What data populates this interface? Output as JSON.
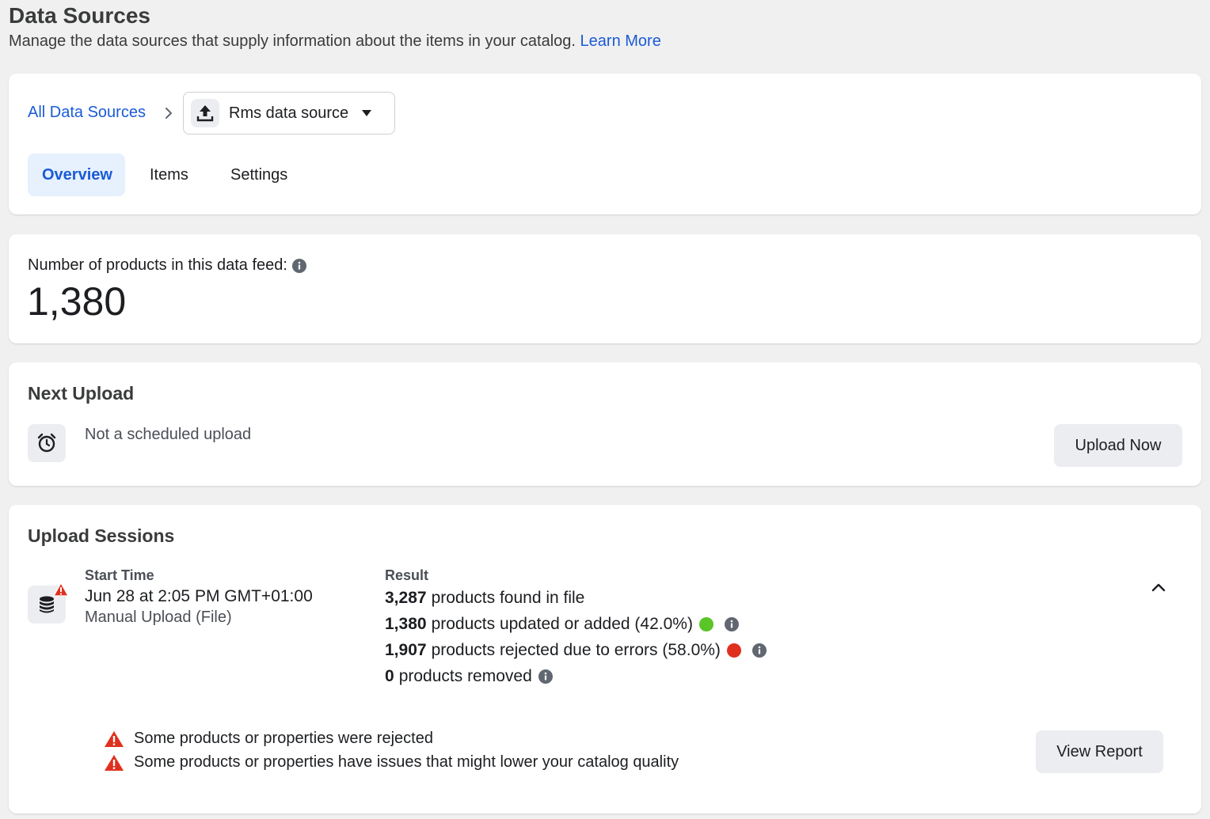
{
  "header": {
    "title": "Data Sources",
    "subtitle": "Manage the data sources that supply information about the items in your catalog.",
    "learn_more": "Learn More"
  },
  "nav": {
    "breadcrumb_root": "All Data Sources",
    "selected_source": "Rms data source",
    "tabs": [
      {
        "label": "Overview",
        "active": true
      },
      {
        "label": "Items",
        "active": false
      },
      {
        "label": "Settings",
        "active": false
      }
    ]
  },
  "products": {
    "label": "Number of products in this data feed:",
    "count": "1,380"
  },
  "next_upload": {
    "title": "Next Upload",
    "status": "Not a scheduled upload",
    "button": "Upload Now"
  },
  "sessions": {
    "title": "Upload Sessions",
    "start_time_header": "Start Time",
    "result_header": "Result",
    "start_time": "Jun 28 at 2:05 PM GMT+01:00",
    "upload_type": "Manual Upload (File)",
    "results": [
      {
        "count": "3,287",
        "text": "products found in file"
      },
      {
        "count": "1,380",
        "text": "products updated or added (42.0%)",
        "status_color": "#5ac526"
      },
      {
        "count": "1,907",
        "text": "products rejected due to errors (58.0%)",
        "status_color": "#e0301e"
      },
      {
        "count": "0",
        "text": "products removed"
      }
    ],
    "warnings": [
      "Some products or properties were rejected",
      "Some products or properties have issues that might lower your catalog quality"
    ],
    "report_button": "View Report"
  },
  "colors": {
    "accent": "#1a5bd6",
    "success": "#5ac526",
    "error": "#e0301e",
    "warning": "#e0301e"
  }
}
